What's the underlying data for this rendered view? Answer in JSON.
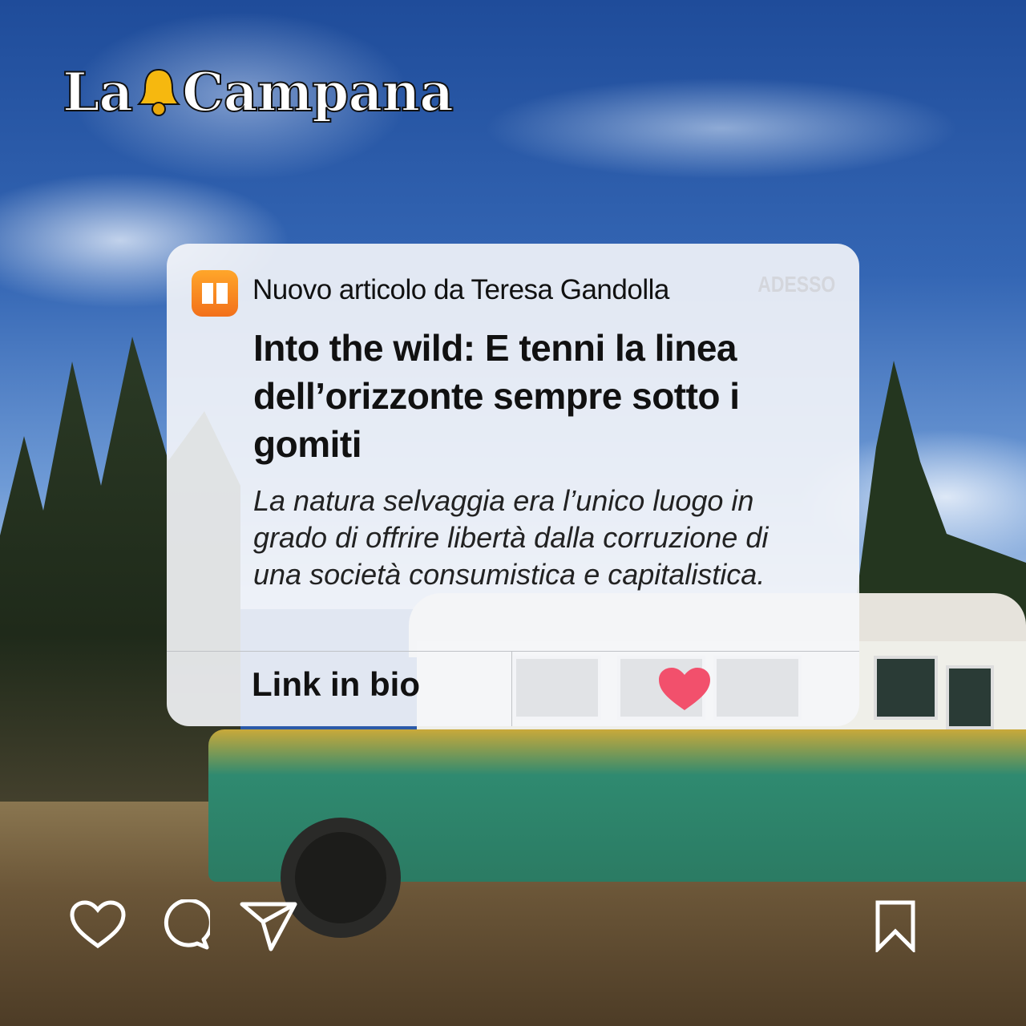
{
  "brand": {
    "logo_text_left": "La",
    "logo_text_right": "Campana",
    "bell_color": "#f6b80f"
  },
  "notification": {
    "app_icon": "books-icon",
    "sender": "Nuovo articolo da Teresa Gandolla",
    "time": "ADESSO",
    "title": "Into the wild: E tenni la linea dell’orizzonte sempre sotto i gomiti",
    "summary": "La natura selvaggia era l’unico luogo in grado di offrire libertà dalla corruzione di una società consumistica e capitalistica.",
    "link_label": "Link in bio",
    "heart_color": "#f2506c"
  },
  "actions": [
    "heart-icon",
    "comment-icon",
    "send-icon",
    "bookmark-icon"
  ]
}
